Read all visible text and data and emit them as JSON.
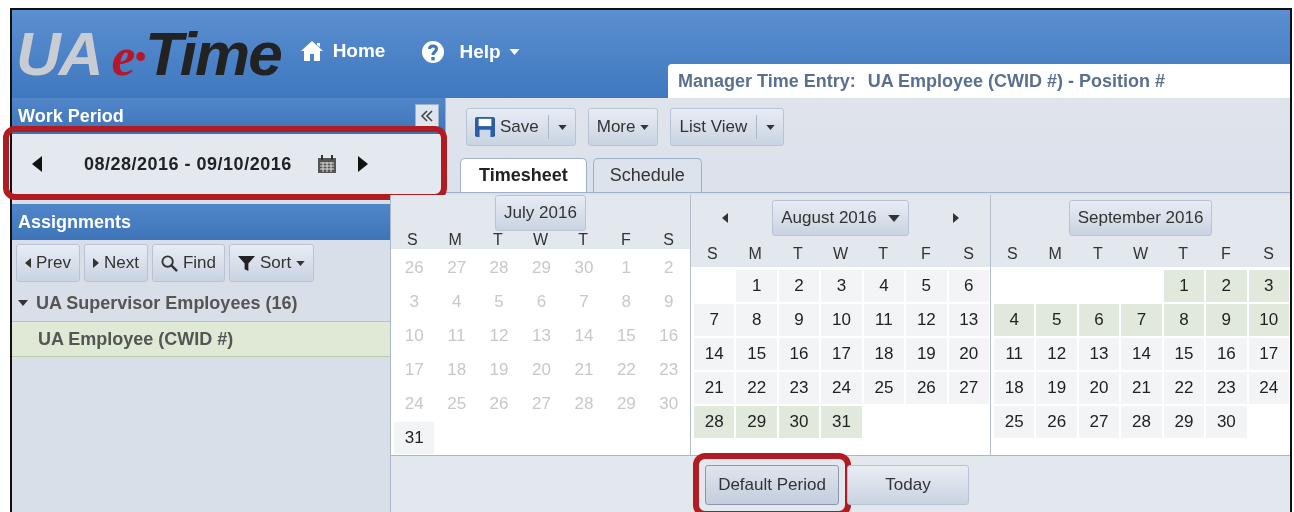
{
  "logo": {
    "parts": [
      {
        "text": "UA",
        "kind": "silver"
      },
      {
        "text": "e·",
        "kind": "red"
      },
      {
        "text": "Time",
        "kind": "dark"
      }
    ]
  },
  "nav": [
    {
      "label": "Home",
      "dropdown": false
    },
    {
      "label": "Help",
      "dropdown": true
    }
  ],
  "title_bar": {
    "label": "Manager Time Entry:",
    "value": "UA Employee (CWID #) - Position #"
  },
  "work_period": {
    "title": "Work Period",
    "range": "08/28/2016 - 09/10/2016",
    "highlighted": true
  },
  "assignments": {
    "title": "Assignments",
    "buttons": [
      {
        "label": "Prev",
        "dropdown": false
      },
      {
        "label": "Next",
        "dropdown": false
      },
      {
        "label": "Find",
        "dropdown": false
      },
      {
        "label": "Sort",
        "dropdown": true
      }
    ],
    "tree": [
      {
        "label": "UA Supervisor Employees (16)",
        "expanded": true,
        "selected": false,
        "children": [
          {
            "label": "UA Employee (CWID #)",
            "selected": true
          }
        ]
      }
    ]
  },
  "toolbar": [
    {
      "label": "Save",
      "kind": "split"
    },
    {
      "label": "More",
      "kind": "dropdown"
    },
    {
      "label": "List View",
      "kind": "split"
    }
  ],
  "tabs": [
    {
      "label": "Timesheet",
      "selected": true
    },
    {
      "label": "Schedule",
      "selected": false
    }
  ],
  "calendar": {
    "months": [
      {
        "title": "July 2016",
        "navigation": false,
        "weekdays": [
          "S",
          "M",
          "T",
          "W",
          "T",
          "F",
          "S"
        ],
        "weeks": [
          [
            {
              "kind": "day",
              "day": "26",
              "disabled": true,
              "selected": false
            },
            {
              "kind": "day",
              "day": "27",
              "disabled": true,
              "selected": false
            },
            {
              "kind": "day",
              "day": "28",
              "disabled": true,
              "selected": false
            },
            {
              "kind": "day",
              "day": "29",
              "disabled": true,
              "selected": false
            },
            {
              "kind": "day",
              "day": "30",
              "disabled": true,
              "selected": false
            },
            {
              "kind": "day",
              "day": "1",
              "disabled": true,
              "selected": false
            },
            {
              "kind": "day",
              "day": "2",
              "disabled": true,
              "selected": false
            }
          ],
          [
            {
              "kind": "day",
              "day": "3",
              "disabled": true,
              "selected": false
            },
            {
              "kind": "day",
              "day": "4",
              "disabled": true,
              "selected": false
            },
            {
              "kind": "day",
              "day": "5",
              "disabled": true,
              "selected": false
            },
            {
              "kind": "day",
              "day": "6",
              "disabled": true,
              "selected": false
            },
            {
              "kind": "day",
              "day": "7",
              "disabled": true,
              "selected": false
            },
            {
              "kind": "day",
              "day": "8",
              "disabled": true,
              "selected": false
            },
            {
              "kind": "day",
              "day": "9",
              "disabled": true,
              "selected": false
            }
          ],
          [
            {
              "kind": "day",
              "day": "10",
              "disabled": true,
              "selected": false
            },
            {
              "kind": "day",
              "day": "11",
              "disabled": true,
              "selected": false
            },
            {
              "kind": "day",
              "day": "12",
              "disabled": true,
              "selected": false
            },
            {
              "kind": "day",
              "day": "13",
              "disabled": true,
              "selected": false
            },
            {
              "kind": "day",
              "day": "14",
              "disabled": true,
              "selected": false
            },
            {
              "kind": "day",
              "day": "15",
              "disabled": true,
              "selected": false
            },
            {
              "kind": "day",
              "day": "16",
              "disabled": true,
              "selected": false
            }
          ],
          [
            {
              "kind": "day",
              "day": "17",
              "disabled": true,
              "selected": false
            },
            {
              "kind": "day",
              "day": "18",
              "disabled": true,
              "selected": false
            },
            {
              "kind": "day",
              "day": "19",
              "disabled": true,
              "selected": false
            },
            {
              "kind": "day",
              "day": "20",
              "disabled": true,
              "selected": false
            },
            {
              "kind": "day",
              "day": "21",
              "disabled": true,
              "selected": false
            },
            {
              "kind": "day",
              "day": "22",
              "disabled": true,
              "selected": false
            },
            {
              "kind": "day",
              "day": "23",
              "disabled": true,
              "selected": false
            }
          ],
          [
            {
              "kind": "day",
              "day": "24",
              "disabled": true,
              "selected": false
            },
            {
              "kind": "day",
              "day": "25",
              "disabled": true,
              "selected": false
            },
            {
              "kind": "day",
              "day": "26",
              "disabled": true,
              "selected": false
            },
            {
              "kind": "day",
              "day": "27",
              "disabled": true,
              "selected": false
            },
            {
              "kind": "day",
              "day": "28",
              "disabled": true,
              "selected": false
            },
            {
              "kind": "day",
              "day": "29",
              "disabled": true,
              "selected": false
            },
            {
              "kind": "day",
              "day": "30",
              "disabled": true,
              "selected": false
            }
          ],
          [
            {
              "kind": "day",
              "day": "31",
              "disabled": false,
              "selected": false
            }
          ]
        ]
      },
      {
        "title": "August 2016",
        "navigation": true,
        "weekdays": [
          "S",
          "M",
          "T",
          "W",
          "T",
          "F",
          "S"
        ],
        "weeks": [
          [
            {
              "kind": "blank"
            },
            {
              "kind": "day",
              "day": "1",
              "disabled": false,
              "selected": false
            },
            {
              "kind": "day",
              "day": "2",
              "disabled": false,
              "selected": false
            },
            {
              "kind": "day",
              "day": "3",
              "disabled": false,
              "selected": false
            },
            {
              "kind": "day",
              "day": "4",
              "disabled": false,
              "selected": false
            },
            {
              "kind": "day",
              "day": "5",
              "disabled": false,
              "selected": false
            },
            {
              "kind": "day",
              "day": "6",
              "disabled": false,
              "selected": false
            }
          ],
          [
            {
              "kind": "day",
              "day": "7",
              "disabled": false,
              "selected": false
            },
            {
              "kind": "day",
              "day": "8",
              "disabled": false,
              "selected": false
            },
            {
              "kind": "day",
              "day": "9",
              "disabled": false,
              "selected": false
            },
            {
              "kind": "day",
              "day": "10",
              "disabled": false,
              "selected": false
            },
            {
              "kind": "day",
              "day": "11",
              "disabled": false,
              "selected": false
            },
            {
              "kind": "day",
              "day": "12",
              "disabled": false,
              "selected": false
            },
            {
              "kind": "day",
              "day": "13",
              "disabled": false,
              "selected": false
            }
          ],
          [
            {
              "kind": "day",
              "day": "14",
              "disabled": false,
              "selected": false
            },
            {
              "kind": "day",
              "day": "15",
              "disabled": false,
              "selected": false
            },
            {
              "kind": "day",
              "day": "16",
              "disabled": false,
              "selected": false
            },
            {
              "kind": "day",
              "day": "17",
              "disabled": false,
              "selected": false
            },
            {
              "kind": "day",
              "day": "18",
              "disabled": false,
              "selected": false
            },
            {
              "kind": "day",
              "day": "19",
              "disabled": false,
              "selected": false
            },
            {
              "kind": "day",
              "day": "20",
              "disabled": false,
              "selected": false
            }
          ],
          [
            {
              "kind": "day",
              "day": "21",
              "disabled": false,
              "selected": false
            },
            {
              "kind": "day",
              "day": "22",
              "disabled": false,
              "selected": false
            },
            {
              "kind": "day",
              "day": "23",
              "disabled": false,
              "selected": false
            },
            {
              "kind": "day",
              "day": "24",
              "disabled": false,
              "selected": false
            },
            {
              "kind": "day",
              "day": "25",
              "disabled": false,
              "selected": false
            },
            {
              "kind": "day",
              "day": "26",
              "disabled": false,
              "selected": false
            },
            {
              "kind": "day",
              "day": "27",
              "disabled": false,
              "selected": false
            }
          ],
          [
            {
              "kind": "day",
              "day": "28",
              "disabled": false,
              "selected": true
            },
            {
              "kind": "day",
              "day": "29",
              "disabled": false,
              "selected": true
            },
            {
              "kind": "day",
              "day": "30",
              "disabled": false,
              "selected": true
            },
            {
              "kind": "day",
              "day": "31",
              "disabled": false,
              "selected": true
            }
          ]
        ]
      },
      {
        "title": "September 2016",
        "navigation": false,
        "weekdays": [
          "S",
          "M",
          "T",
          "W",
          "T",
          "F",
          "S"
        ],
        "weeks": [
          [
            {
              "kind": "blank"
            },
            {
              "kind": "blank"
            },
            {
              "kind": "blank"
            },
            {
              "kind": "blank"
            },
            {
              "kind": "day",
              "day": "1",
              "disabled": false,
              "selected": true
            },
            {
              "kind": "day",
              "day": "2",
              "disabled": false,
              "selected": true
            },
            {
              "kind": "day",
              "day": "3",
              "disabled": false,
              "selected": true
            }
          ],
          [
            {
              "kind": "day",
              "day": "4",
              "disabled": false,
              "selected": true
            },
            {
              "kind": "day",
              "day": "5",
              "disabled": false,
              "selected": true
            },
            {
              "kind": "day",
              "day": "6",
              "disabled": false,
              "selected": true
            },
            {
              "kind": "day",
              "day": "7",
              "disabled": false,
              "selected": true
            },
            {
              "kind": "day",
              "day": "8",
              "disabled": false,
              "selected": true
            },
            {
              "kind": "day",
              "day": "9",
              "disabled": false,
              "selected": true
            },
            {
              "kind": "day",
              "day": "10",
              "disabled": false,
              "selected": true
            }
          ],
          [
            {
              "kind": "day",
              "day": "11",
              "disabled": false,
              "selected": false
            },
            {
              "kind": "day",
              "day": "12",
              "disabled": false,
              "selected": false
            },
            {
              "kind": "day",
              "day": "13",
              "disabled": false,
              "selected": false
            },
            {
              "kind": "day",
              "day": "14",
              "disabled": false,
              "selected": false
            },
            {
              "kind": "day",
              "day": "15",
              "disabled": false,
              "selected": false
            },
            {
              "kind": "day",
              "day": "16",
              "disabled": false,
              "selected": false
            },
            {
              "kind": "day",
              "day": "17",
              "disabled": false,
              "selected": false
            }
          ],
          [
            {
              "kind": "day",
              "day": "18",
              "disabled": false,
              "selected": false
            },
            {
              "kind": "day",
              "day": "19",
              "disabled": false,
              "selected": false
            },
            {
              "kind": "day",
              "day": "20",
              "disabled": false,
              "selected": false
            },
            {
              "kind": "day",
              "day": "21",
              "disabled": false,
              "selected": false
            },
            {
              "kind": "day",
              "day": "22",
              "disabled": false,
              "selected": false
            },
            {
              "kind": "day",
              "day": "23",
              "disabled": false,
              "selected": false
            },
            {
              "kind": "day",
              "day": "24",
              "disabled": false,
              "selected": false
            }
          ],
          [
            {
              "kind": "day",
              "day": "25",
              "disabled": false,
              "selected": false
            },
            {
              "kind": "day",
              "day": "26",
              "disabled": false,
              "selected": false
            },
            {
              "kind": "day",
              "day": "27",
              "disabled": false,
              "selected": false
            },
            {
              "kind": "day",
              "day": "28",
              "disabled": false,
              "selected": false
            },
            {
              "kind": "day",
              "day": "29",
              "disabled": false,
              "selected": false
            },
            {
              "kind": "day",
              "day": "30",
              "disabled": false,
              "selected": false
            }
          ]
        ]
      }
    ],
    "footer_buttons": [
      {
        "label": "Default Period",
        "highlighted": true
      },
      {
        "label": "Today",
        "highlighted": false
      }
    ]
  }
}
